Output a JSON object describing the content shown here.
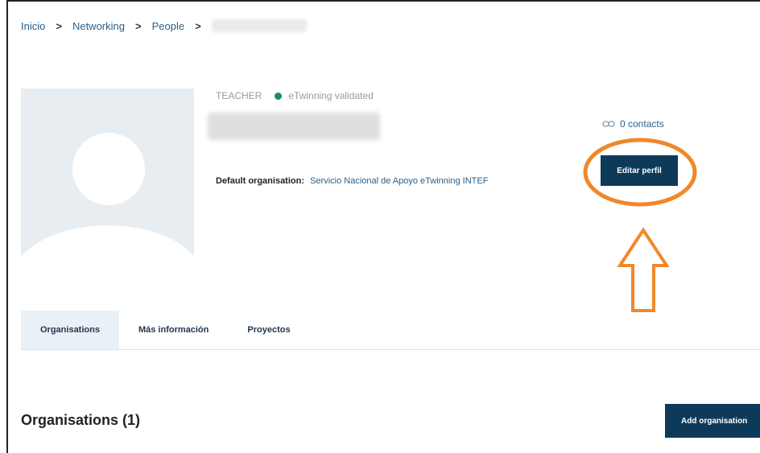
{
  "breadcrumb": {
    "items": [
      "Inicio",
      "Networking",
      "People"
    ],
    "separator": ">"
  },
  "profile": {
    "role": "TEACHER",
    "status_text": "eTwinning validated",
    "status_color": "#1b8a6b",
    "default_org_label": "Default organisation:",
    "default_org_value": "Servicio Nacional de Apoyo eTwinning INTEF",
    "contacts_icon": "link-icon",
    "contacts_text": "0 contacts",
    "edit_button_label": "Editar perfil"
  },
  "annotation": {
    "color": "#f0882a",
    "shapes": [
      "ellipse",
      "up-arrow"
    ]
  },
  "tabs": [
    {
      "label": "Organisations",
      "active": true
    },
    {
      "label": "Más información",
      "active": false
    },
    {
      "label": "Proyectos",
      "active": false
    }
  ],
  "section": {
    "title": "Organisations (1)",
    "add_button_label": "Add organisation"
  },
  "colors": {
    "primary_button": "#0e3a5a",
    "link": "#2a5f86",
    "active_tab_bg": "#e9f1f7"
  }
}
